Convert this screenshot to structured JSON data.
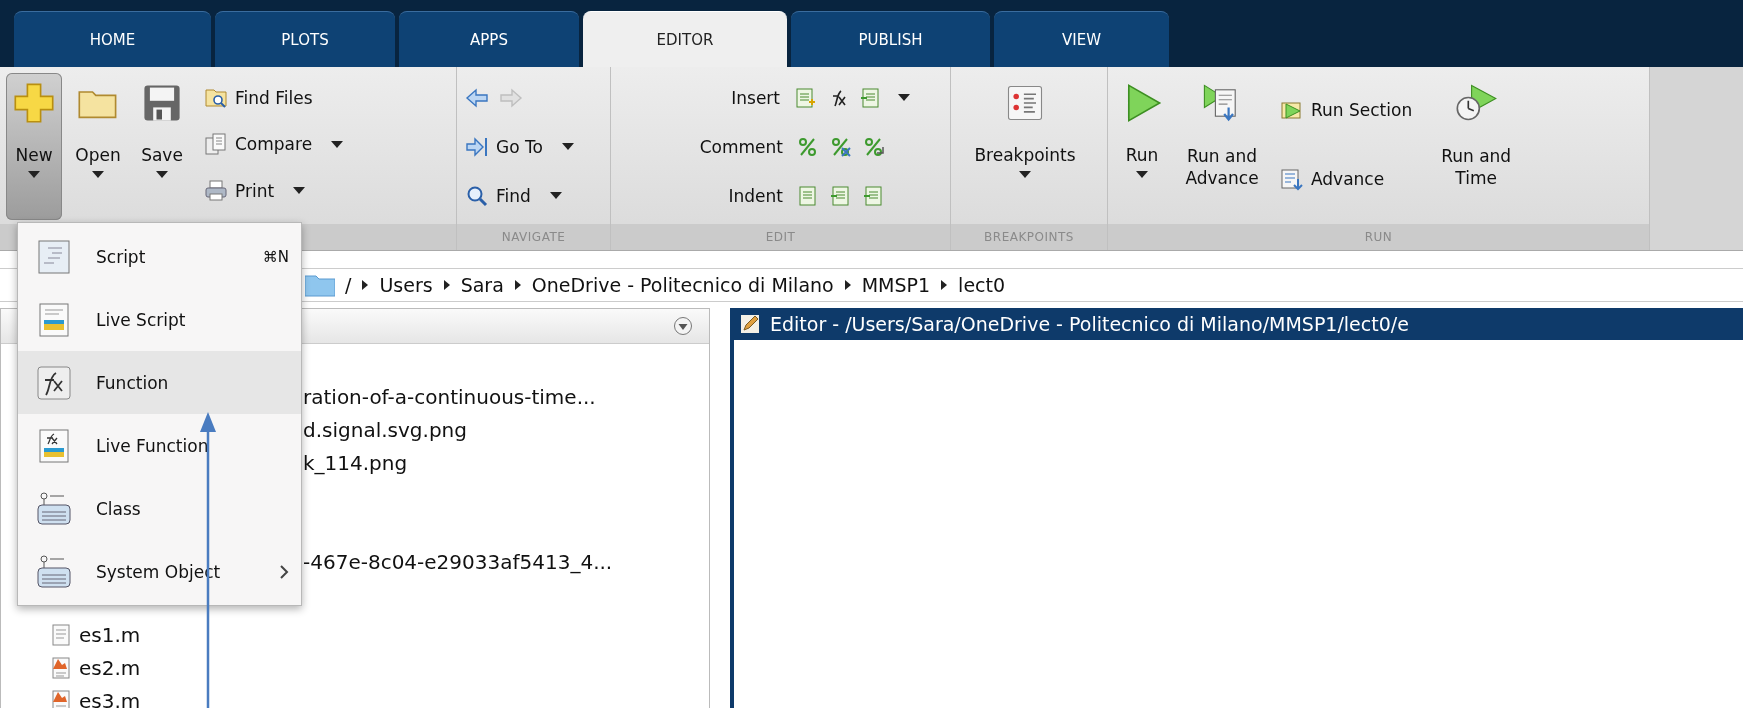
{
  "tabs": [
    {
      "label": "HOME",
      "selected": false
    },
    {
      "label": "PLOTS",
      "selected": false
    },
    {
      "label": "APPS",
      "selected": false
    },
    {
      "label": "EDITOR",
      "selected": true
    },
    {
      "label": "PUBLISH",
      "selected": false
    },
    {
      "label": "VIEW",
      "selected": false
    }
  ],
  "file_section": {
    "large_buttons": [
      {
        "label": "New",
        "pressed": true,
        "dropdown": true
      },
      {
        "label": "Open",
        "pressed": false,
        "dropdown": true
      },
      {
        "label": "Save",
        "pressed": false,
        "dropdown": true
      }
    ],
    "small_buttons": [
      {
        "label": "Find Files",
        "dropdown": false
      },
      {
        "label": "Compare",
        "dropdown": true
      },
      {
        "label": "Print",
        "dropdown": true
      }
    ]
  },
  "navigate_section": {
    "label": "NAVIGATE",
    "back": {
      "disabled": false
    },
    "forward": {
      "disabled": true
    },
    "small_buttons": [
      {
        "label": "Go To",
        "dropdown": true
      },
      {
        "label": "Find",
        "dropdown": true
      }
    ]
  },
  "edit_section": {
    "label": "EDIT",
    "rows": [
      {
        "label": "Insert",
        "dropdown": true
      },
      {
        "label": "Comment",
        "dropdown": false
      },
      {
        "label": "Indent",
        "dropdown": false
      }
    ]
  },
  "breakpoints_section": {
    "label": "BREAKPOINTS",
    "button": {
      "label": "Breakpoints",
      "dropdown": true
    }
  },
  "run_section": {
    "label": "RUN",
    "large_buttons": [
      {
        "label": "Run",
        "dropdown": true
      },
      {
        "label": "Run and Advance",
        "dropdown": false
      }
    ],
    "small_buttons": [
      {
        "label": "Run Section"
      },
      {
        "label": "Advance"
      }
    ],
    "time_button": {
      "label": "Run and Time"
    }
  },
  "address_bar": {
    "segments": [
      "/",
      "Users",
      "Sara",
      "OneDrive - Politecnico di Milano",
      "MMSP1",
      "lect0"
    ]
  },
  "file_browser": {
    "rows": [
      {
        "name": "ration-of-a-continuous-time...",
        "kind": "partial"
      },
      {
        "name": "d.signal.svg.png",
        "kind": "partial"
      },
      {
        "name": "k_114.png",
        "kind": "partial"
      },
      {
        "name": "-467e-8c04-e29033af5413_4...",
        "kind": "partial"
      },
      {
        "name": "es1.m",
        "kind": "script"
      },
      {
        "name": "es2.m",
        "kind": "mfile"
      },
      {
        "name": "es3.m",
        "kind": "mfile"
      }
    ]
  },
  "editor": {
    "title": "Editor - /Users/Sara/OneDrive - Politecnico di Milano/MMSP1/lect0/e"
  },
  "new_menu": {
    "items": [
      {
        "label": "Script",
        "shortcut": "⌘N",
        "submenu": false,
        "selected": false
      },
      {
        "label": "Live Script",
        "submenu": false,
        "selected": false
      },
      {
        "label": "Function",
        "submenu": false,
        "selected": true
      },
      {
        "label": "Live Function",
        "submenu": false,
        "selected": false
      },
      {
        "label": "Class",
        "submenu": false,
        "selected": false
      },
      {
        "label": "System Object",
        "submenu": true,
        "selected": false
      }
    ]
  }
}
